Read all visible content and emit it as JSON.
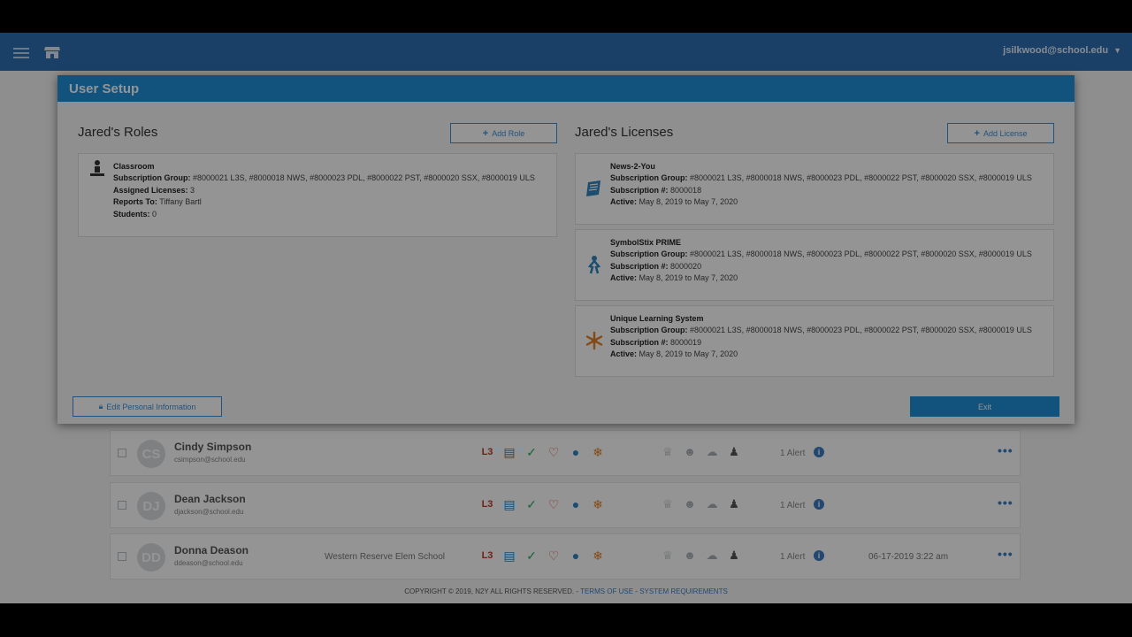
{
  "appbar": {
    "user_email": "jsilkwood@school.edu",
    "icons": [
      "hamburger-menu-icon",
      "store-icon",
      "chevron-down-icon"
    ]
  },
  "modal": {
    "title": "User Setup",
    "roles_title": "Jared's Roles",
    "add_role_label": "Add Role",
    "licenses_title": "Jared's Licenses",
    "add_license_label": "Add License",
    "edit_label": "Edit Personal Information",
    "exit_label": "Exit",
    "role": {
      "name": "Classroom",
      "sub_group_label": "Subscription Group:",
      "sub_group_value": "#8000021 L3S, #8000018 NWS, #8000023 PDL, #8000022 PST, #8000020 SSX, #8000019 ULS",
      "assigned_label": "Assigned Licenses:",
      "assigned_value": "3",
      "reports_label": "Reports To:",
      "reports_value": "Tiffany Bartl",
      "students_label": "Students:",
      "students_value": "0"
    },
    "licenses": [
      {
        "name": "News-2-You",
        "sub_group_label": "Subscription Group:",
        "sub_group_value": "#8000021 L3S, #8000018 NWS, #8000023 PDL, #8000022 PST, #8000020 SSX, #8000019 ULS",
        "sub_num_label": "Subscription #:",
        "sub_num_value": "8000018",
        "active_label": "Active:",
        "active_value": "May 8, 2019 to May 7, 2020",
        "icon": "newspaper-icon"
      },
      {
        "name": "SymbolStix PRIME",
        "sub_group_label": "Subscription Group:",
        "sub_group_value": "#8000021 L3S, #8000018 NWS, #8000023 PDL, #8000022 PST, #8000020 SSX, #8000019 ULS",
        "sub_num_label": "Subscription #:",
        "sub_num_value": "8000020",
        "active_label": "Active:",
        "active_value": "May 8, 2019 to May 7, 2020",
        "icon": "symbolstix-figure-icon"
      },
      {
        "name": "Unique Learning System",
        "sub_group_label": "Subscription Group:",
        "sub_group_value": "#8000021 L3S, #8000018 NWS, #8000023 PDL, #8000022 PST, #8000020 SSX, #8000019 ULS",
        "sub_num_label": "Subscription #:",
        "sub_num_value": "8000019",
        "active_label": "Active:",
        "active_value": "May 8, 2019 to May 7, 2020",
        "icon": "snowflake-icon"
      }
    ]
  },
  "users": [
    {
      "initials": "CS",
      "name": "Cindy Simpson",
      "email": "csimpson@school.edu",
      "school": "",
      "alert": "1 Alert",
      "date": ""
    },
    {
      "initials": "DJ",
      "name": "Dean Jackson",
      "email": "djackson@school.edu",
      "school": "",
      "alert": "1 Alert",
      "date": ""
    },
    {
      "initials": "DD",
      "name": "Donna Deason",
      "email": "ddeason@school.edu",
      "school": "Western Reserve Elem School",
      "alert": "1 Alert",
      "date": "06-17-2019 3:22 am"
    }
  ],
  "footer": {
    "copyright": "COPYRIGHT © 2019, N2Y ALL RIGHTS RESERVED. -",
    "terms": "TERMS OF USE",
    "sep": "-",
    "sysreq": "SYSTEM REQUIREMENTS"
  },
  "colors": {
    "appbar": "#2f6fb3",
    "modal_header": "#1f8fd8",
    "accent": "#3b8fd6"
  }
}
